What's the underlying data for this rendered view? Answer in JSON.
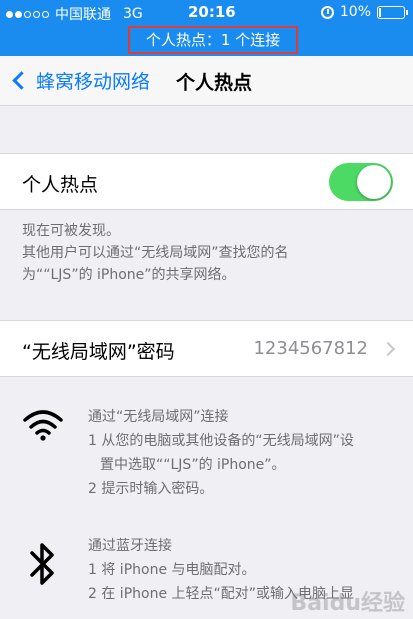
{
  "status_bar": {
    "carrier": "中国联通",
    "network": "3G",
    "time": "20:16",
    "battery": "10%",
    "battery_level": 0.1,
    "signal_bars_filled": 2
  },
  "banner": {
    "text": "个人热点：1 个连接"
  },
  "nav": {
    "back_label": "蜂窝移动网络",
    "title": "个人热点"
  },
  "hotspot": {
    "label": "个人热点",
    "enabled": true
  },
  "discover": {
    "line1": "现在可被发现。",
    "line2": "其他用户可以通过“无线局域网”查找您的名",
    "line3": "为““LJS”的 iPhone”的共享网络。"
  },
  "password": {
    "label": "“无线局域网”密码",
    "value": "1234567812"
  },
  "wifi_instructions": {
    "title": "通过“无线局域网”连接",
    "step1a": "1 从您的电脑或其他设备的“无线局域网”设",
    "step1b": "置中选取““LJS”的 iPhone”。",
    "step2": "2 提示时输入密码。"
  },
  "bt_instructions": {
    "title": "通过蓝牙连接",
    "step1": "1 将 iPhone 与电脑配对。",
    "step2": "2 在 iPhone 上轻点“配对”或输入电脑上显"
  },
  "colors": {
    "accent": "#0a7aff",
    "status_bg": "#1a8cf0",
    "toggle_on": "#4cd964",
    "banner_border": "#e53935"
  },
  "watermark": "Baidu经验"
}
